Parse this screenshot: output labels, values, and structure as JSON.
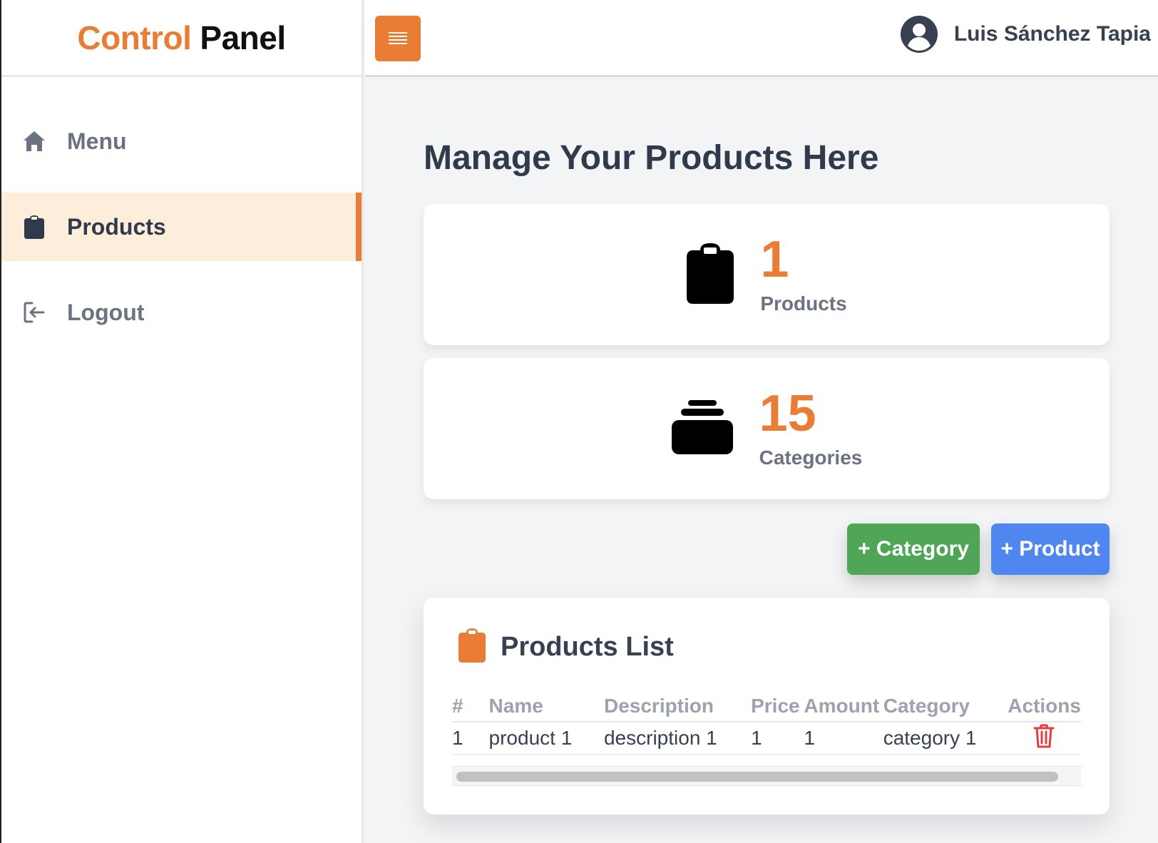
{
  "brand": {
    "part1": "Control",
    "part2": "Panel"
  },
  "sidebar": {
    "items": [
      {
        "label": "Menu",
        "icon": "home-icon",
        "active": false
      },
      {
        "label": "Products",
        "icon": "clipboard-icon",
        "active": true
      },
      {
        "label": "Logout",
        "icon": "logout-icon",
        "active": false
      }
    ]
  },
  "header": {
    "user_name": "Luis Sánchez Tapia"
  },
  "main": {
    "title": "Manage Your Products Here",
    "stats": [
      {
        "value": "1",
        "label": "Products",
        "icon": "clipboard-icon"
      },
      {
        "value": "15",
        "label": "Categories",
        "icon": "layers-icon"
      }
    ],
    "buttons": {
      "add_category": "+ Category",
      "add_product": "+ Product"
    },
    "products_list": {
      "title": "Products List",
      "columns": [
        "#",
        "Name",
        "Description",
        "Price",
        "Amount",
        "Category",
        "Actions"
      ],
      "rows": [
        {
          "id": "1",
          "name": "product 1",
          "description": "description 1",
          "price": "1",
          "amount": "1",
          "category": "category 1"
        }
      ]
    }
  },
  "colors": {
    "accent": "#ea7d35",
    "green": "#4ea656",
    "blue": "#4f86f0",
    "delete": "#e53e3e"
  }
}
